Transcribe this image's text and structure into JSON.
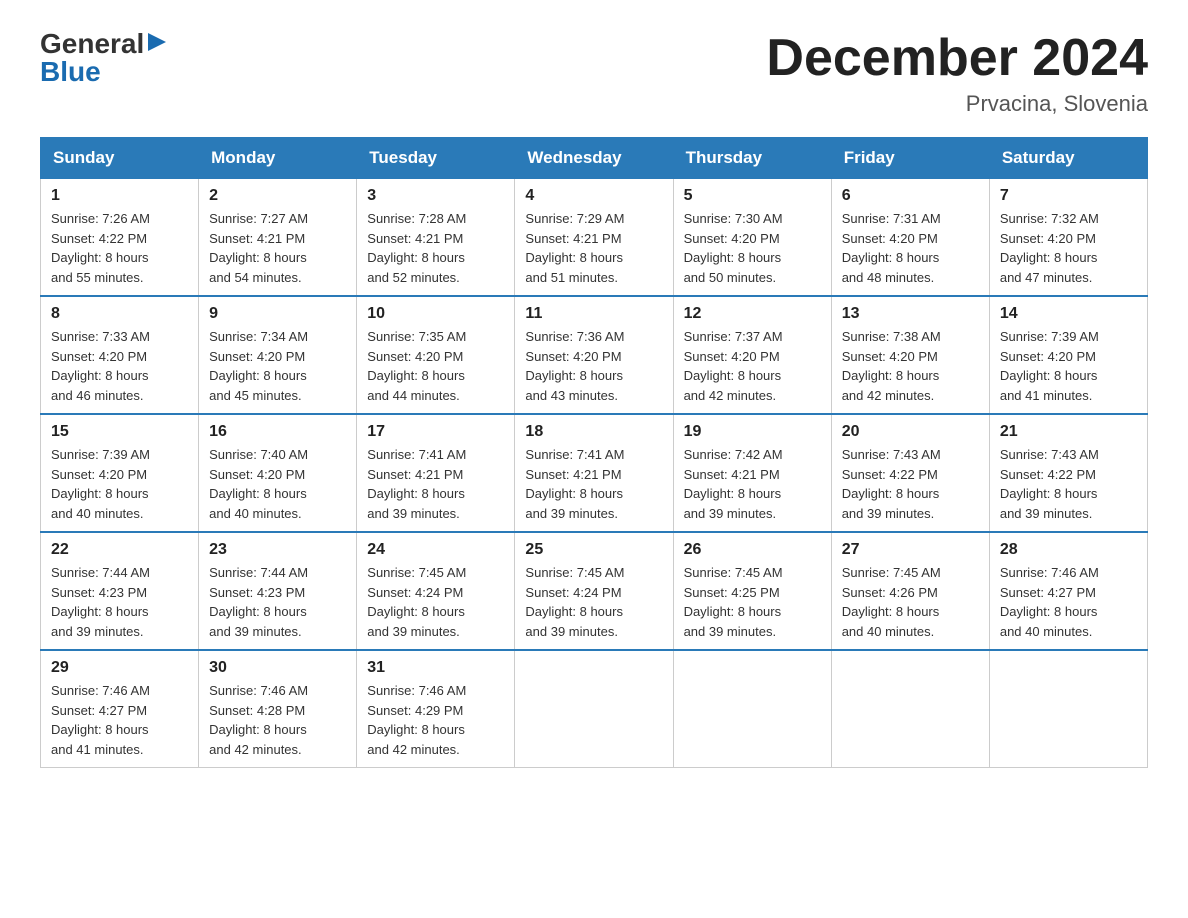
{
  "logo": {
    "general": "General",
    "blue": "Blue",
    "triangle": "▶"
  },
  "title": "December 2024",
  "location": "Prvacina, Slovenia",
  "headers": [
    "Sunday",
    "Monday",
    "Tuesday",
    "Wednesday",
    "Thursday",
    "Friday",
    "Saturday"
  ],
  "weeks": [
    [
      {
        "day": "1",
        "sunrise": "7:26 AM",
        "sunset": "4:22 PM",
        "daylight": "8 hours and 55 minutes."
      },
      {
        "day": "2",
        "sunrise": "7:27 AM",
        "sunset": "4:21 PM",
        "daylight": "8 hours and 54 minutes."
      },
      {
        "day": "3",
        "sunrise": "7:28 AM",
        "sunset": "4:21 PM",
        "daylight": "8 hours and 52 minutes."
      },
      {
        "day": "4",
        "sunrise": "7:29 AM",
        "sunset": "4:21 PM",
        "daylight": "8 hours and 51 minutes."
      },
      {
        "day": "5",
        "sunrise": "7:30 AM",
        "sunset": "4:20 PM",
        "daylight": "8 hours and 50 minutes."
      },
      {
        "day": "6",
        "sunrise": "7:31 AM",
        "sunset": "4:20 PM",
        "daylight": "8 hours and 48 minutes."
      },
      {
        "day": "7",
        "sunrise": "7:32 AM",
        "sunset": "4:20 PM",
        "daylight": "8 hours and 47 minutes."
      }
    ],
    [
      {
        "day": "8",
        "sunrise": "7:33 AM",
        "sunset": "4:20 PM",
        "daylight": "8 hours and 46 minutes."
      },
      {
        "day": "9",
        "sunrise": "7:34 AM",
        "sunset": "4:20 PM",
        "daylight": "8 hours and 45 minutes."
      },
      {
        "day": "10",
        "sunrise": "7:35 AM",
        "sunset": "4:20 PM",
        "daylight": "8 hours and 44 minutes."
      },
      {
        "day": "11",
        "sunrise": "7:36 AM",
        "sunset": "4:20 PM",
        "daylight": "8 hours and 43 minutes."
      },
      {
        "day": "12",
        "sunrise": "7:37 AM",
        "sunset": "4:20 PM",
        "daylight": "8 hours and 42 minutes."
      },
      {
        "day": "13",
        "sunrise": "7:38 AM",
        "sunset": "4:20 PM",
        "daylight": "8 hours and 42 minutes."
      },
      {
        "day": "14",
        "sunrise": "7:39 AM",
        "sunset": "4:20 PM",
        "daylight": "8 hours and 41 minutes."
      }
    ],
    [
      {
        "day": "15",
        "sunrise": "7:39 AM",
        "sunset": "4:20 PM",
        "daylight": "8 hours and 40 minutes."
      },
      {
        "day": "16",
        "sunrise": "7:40 AM",
        "sunset": "4:20 PM",
        "daylight": "8 hours and 40 minutes."
      },
      {
        "day": "17",
        "sunrise": "7:41 AM",
        "sunset": "4:21 PM",
        "daylight": "8 hours and 39 minutes."
      },
      {
        "day": "18",
        "sunrise": "7:41 AM",
        "sunset": "4:21 PM",
        "daylight": "8 hours and 39 minutes."
      },
      {
        "day": "19",
        "sunrise": "7:42 AM",
        "sunset": "4:21 PM",
        "daylight": "8 hours and 39 minutes."
      },
      {
        "day": "20",
        "sunrise": "7:43 AM",
        "sunset": "4:22 PM",
        "daylight": "8 hours and 39 minutes."
      },
      {
        "day": "21",
        "sunrise": "7:43 AM",
        "sunset": "4:22 PM",
        "daylight": "8 hours and 39 minutes."
      }
    ],
    [
      {
        "day": "22",
        "sunrise": "7:44 AM",
        "sunset": "4:23 PM",
        "daylight": "8 hours and 39 minutes."
      },
      {
        "day": "23",
        "sunrise": "7:44 AM",
        "sunset": "4:23 PM",
        "daylight": "8 hours and 39 minutes."
      },
      {
        "day": "24",
        "sunrise": "7:45 AM",
        "sunset": "4:24 PM",
        "daylight": "8 hours and 39 minutes."
      },
      {
        "day": "25",
        "sunrise": "7:45 AM",
        "sunset": "4:24 PM",
        "daylight": "8 hours and 39 minutes."
      },
      {
        "day": "26",
        "sunrise": "7:45 AM",
        "sunset": "4:25 PM",
        "daylight": "8 hours and 39 minutes."
      },
      {
        "day": "27",
        "sunrise": "7:45 AM",
        "sunset": "4:26 PM",
        "daylight": "8 hours and 40 minutes."
      },
      {
        "day": "28",
        "sunrise": "7:46 AM",
        "sunset": "4:27 PM",
        "daylight": "8 hours and 40 minutes."
      }
    ],
    [
      {
        "day": "29",
        "sunrise": "7:46 AM",
        "sunset": "4:27 PM",
        "daylight": "8 hours and 41 minutes."
      },
      {
        "day": "30",
        "sunrise": "7:46 AM",
        "sunset": "4:28 PM",
        "daylight": "8 hours and 42 minutes."
      },
      {
        "day": "31",
        "sunrise": "7:46 AM",
        "sunset": "4:29 PM",
        "daylight": "8 hours and 42 minutes."
      },
      null,
      null,
      null,
      null
    ]
  ],
  "labels": {
    "sunrise": "Sunrise:",
    "sunset": "Sunset:",
    "daylight": "Daylight:"
  }
}
